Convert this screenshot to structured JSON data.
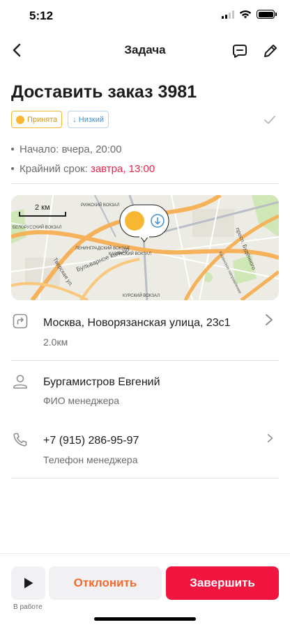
{
  "status_bar": {
    "time": "5:12",
    "icons": [
      "signal-icon",
      "wifi-icon",
      "battery-icon"
    ]
  },
  "nav": {
    "title": "Задача",
    "back_icon": "chevron-left-icon",
    "comment_icon": "comment-icon",
    "edit_icon": "pencil-icon"
  },
  "task": {
    "title": "Доставить заказ 3981",
    "status_badge": "Принята",
    "priority_badge": "↓ Низкий",
    "start_label": "Начало: вчера, 20:00",
    "deadline_label": "Крайний срок:",
    "deadline_value": "завтра, 13:00"
  },
  "map": {
    "scale_label": "2 км",
    "places": [
      "РИЖСКИЙ ВОКЗАЛ",
      "ЛЕНИНГРАДСКИЙ ВОКЗАЛ",
      "КАЗАНСКИЙ ВОКЗАЛ",
      "КУРСКИЙ ВОКЗАЛ",
      "БЕЛОРУССКИЙ ВОКЗАЛ",
      "Бульварное кольцо",
      "Тверская ул.",
      "просп. Будённого",
      "Казанское направление"
    ]
  },
  "address": {
    "text": "Москва, Новорязанская улица, 23с1",
    "distance": "2.0км"
  },
  "manager": {
    "name": "Бургамистров Евгений",
    "name_caption": "ФИО менеджера",
    "phone": "+7 (915) 286-95-97",
    "phone_caption": "Телефон менеджера"
  },
  "actions": {
    "play_label": "В работе",
    "decline_label": "Отклонить",
    "finish_label": "Завершить"
  },
  "colors": {
    "accent_red": "#f0163f",
    "decline_orange": "#f26a2e",
    "status_yellow": "#f7b733",
    "priority_blue": "#3d8fd6",
    "deadline_red": "#e8264b"
  }
}
